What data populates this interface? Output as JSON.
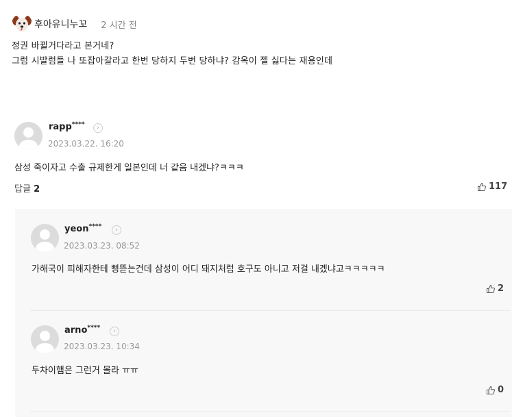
{
  "top_comment": {
    "author": "후아유니누꼬",
    "time": "2 시간 전",
    "lines": [
      "정권 바뀔거다라고 본거네?",
      "그럼 시발럼들 나 또잡아갈라고 한번 당하지 두번 당하냐? 감옥이 젤 싫다는 재용인데"
    ]
  },
  "comment": {
    "author": "rapp",
    "mask": "****",
    "date": "2023.03.22. 16:20",
    "text": "삼성 죽이자고 수출 규제한게 일본인데 너 같음 내겠냐?ㅋㅋㅋ",
    "reply_label": "답글",
    "reply_count": "2",
    "likes": "117"
  },
  "replies": [
    {
      "author": "yeon",
      "mask": "****",
      "date": "2023.03.23. 08:52",
      "text": "가해국이 피해자한테 삥뜯는건데 삼성이 어디 돼지처럼 호구도 아니고 저걸 내겠냐고ㅋㅋㅋㅋㅋ",
      "likes": "2"
    },
    {
      "author": "arno",
      "mask": "****",
      "date": "2023.03.23. 10:34",
      "text": "두차이햄은 그런거 몰라 ㅠㅠ",
      "likes": "0"
    }
  ],
  "icons": {
    "profile_arrow": "›"
  },
  "colors": {
    "avatar_grey": "#dcdcdc",
    "reply_bg": "#f8f8f8",
    "date_grey": "#999999"
  }
}
